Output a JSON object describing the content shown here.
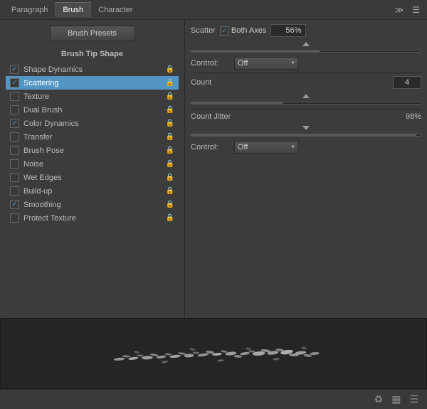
{
  "tabs": [
    {
      "label": "Paragraph",
      "active": false
    },
    {
      "label": "Brush",
      "active": true
    },
    {
      "label": "Character",
      "active": false
    }
  ],
  "left": {
    "brush_presets_label": "Brush Presets",
    "section_header": "Brush Tip Shape",
    "brush_items": [
      {
        "label": "Shape Dynamics",
        "checked": true,
        "active": false
      },
      {
        "label": "Scattering",
        "checked": true,
        "active": true
      },
      {
        "label": "Texture",
        "checked": false,
        "active": false
      },
      {
        "label": "Dual Brush",
        "checked": false,
        "active": false
      },
      {
        "label": "Color Dynamics",
        "checked": true,
        "active": false
      },
      {
        "label": "Transfer",
        "checked": false,
        "active": false
      },
      {
        "label": "Brush Pose",
        "checked": false,
        "active": false
      },
      {
        "label": "Noise",
        "checked": false,
        "active": false
      },
      {
        "label": "Wet Edges",
        "checked": false,
        "active": false
      },
      {
        "label": "Build-up",
        "checked": false,
        "active": false
      },
      {
        "label": "Smoothing",
        "checked": true,
        "active": false
      },
      {
        "label": "Protect Texture",
        "checked": false,
        "active": false
      }
    ]
  },
  "right": {
    "scatter_label": "Scatter",
    "both_axes_label": "Both Axes",
    "both_axes_checked": true,
    "scatter_percent": "56%",
    "control_label": "Control:",
    "control_value": "Off",
    "count_label": "Count",
    "count_value": "4",
    "count_jitter_label": "Count Jitter",
    "count_jitter_percent": "98%",
    "control2_label": "Control:",
    "control2_value": "Off"
  },
  "bottom_icons": [
    "recycle",
    "grid",
    "list"
  ]
}
